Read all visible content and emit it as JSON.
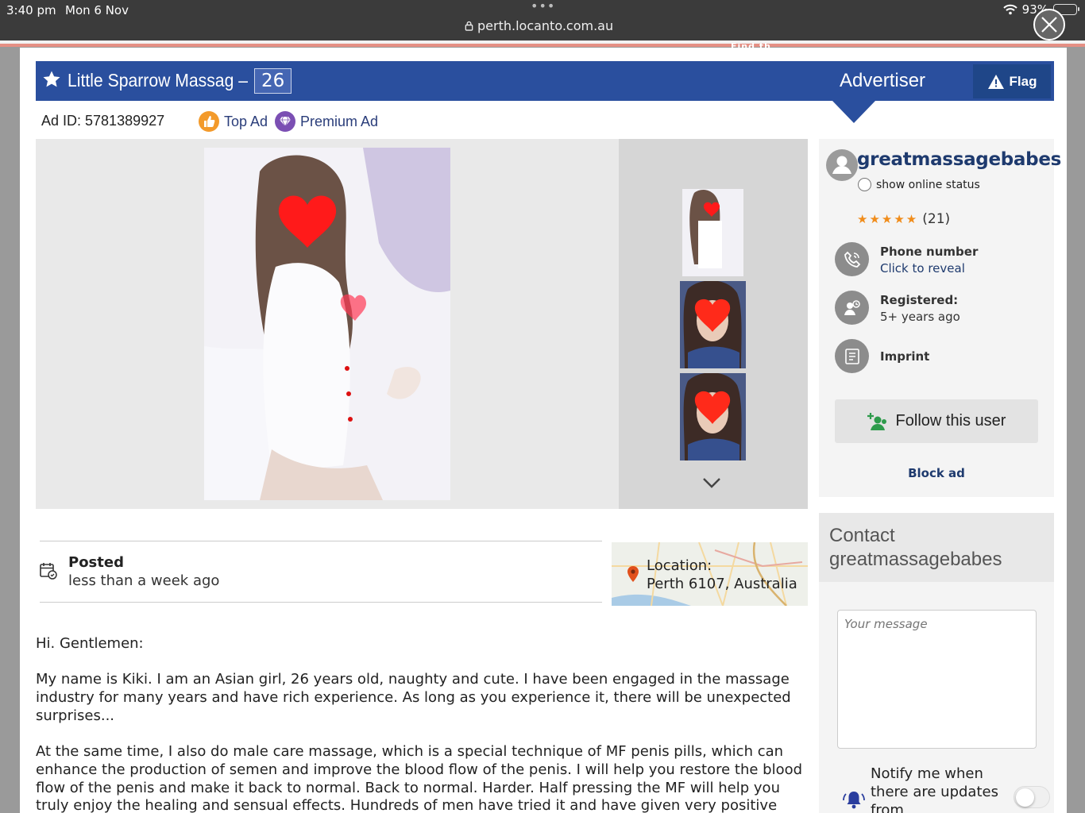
{
  "status_bar": {
    "time": "3:40 pm",
    "date": "Mon 6 Nov",
    "url": "perth.locanto.com.au",
    "battery": "93%",
    "battery_level": 0.93
  },
  "find_text": "Find th",
  "ad": {
    "title": "Little Sparrow Massag –",
    "age": "26",
    "id_text": "Ad ID: 5781389927",
    "badges": [
      "Top Ad",
      "Premium Ad"
    ],
    "flag_label": "Flag",
    "posted_label": "Posted",
    "posted_value": "less than a week ago",
    "location_label": "Location:",
    "location_value": "Perth 6107, Australia",
    "description": [
      "Hi. Gentlemen:",
      "My name is Kiki. I am an Asian girl, 26 years old, naughty and cute. I have been engaged in the massage industry for many years and have rich experience. As long as you experience it, there will be unexpected surprises...",
      "At the same time, I also do male care massage, which is a special technique of MF penis pills, which can enhance the production of semen and improve the blood flow of the penis. I will help you restore the blood flow of the penis and make it back to normal. Back to normal. Harder. Half pressing the MF will help you truly enjoy the healing and sensual effects. Hundreds of men have tried it and have given very positive feedback."
    ]
  },
  "advertiser": {
    "heading": "Advertiser",
    "username": "greatmassagebabes",
    "online_status": "show online status",
    "rating_stars": 5,
    "rating_count": "(21)",
    "phone_label": "Phone number",
    "phone_action": "Click to reveal",
    "registered_label": "Registered:",
    "registered_value": "5+ years ago",
    "imprint_label": "Imprint",
    "follow_label": "Follow this user",
    "block_label": "Block ad"
  },
  "contact": {
    "title_line1": "Contact",
    "title_line2": "greatmassagebabes",
    "message_placeholder": "Your message",
    "notify_text": "Notify me when there are updates from"
  },
  "colors": {
    "header_blue": "#2a4f9e",
    "link_navy": "#1e3a6e",
    "top_ad_orange": "#f39a2b",
    "premium_purple": "#7b4fb3",
    "star_orange": "#f08c1a",
    "follow_green": "#2e9b4c"
  },
  "icons": [
    "lock-icon",
    "wifi-icon",
    "star-icon",
    "warning-icon",
    "close-icon",
    "thumbs-up-icon",
    "diamond-icon",
    "calendar-icon",
    "map-pin-icon",
    "user-avatar-icon",
    "phone-icon",
    "registered-user-icon",
    "imprint-icon",
    "add-user-icon",
    "chevron-down-icon",
    "bell-icon"
  ]
}
